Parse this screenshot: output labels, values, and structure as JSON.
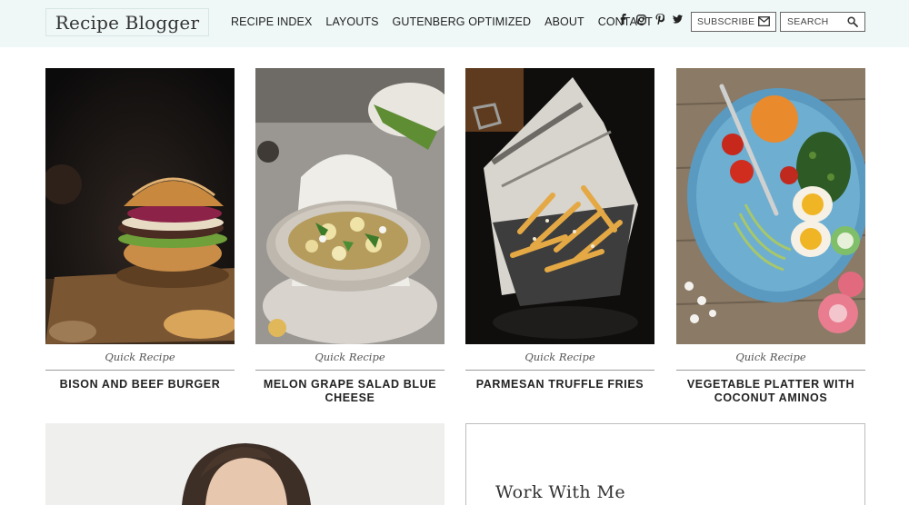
{
  "header": {
    "logo": "Recipe Blogger",
    "nav": [
      "RECIPE INDEX",
      "LAYOUTS",
      "GUTENBERG OPTIMIZED",
      "ABOUT",
      "CONTACT"
    ],
    "social_icons": [
      "facebook-icon",
      "instagram-icon",
      "pinterest-icon",
      "twitter-icon"
    ],
    "subscribe_label": "SUBSCRIBE",
    "search_label": "SEARCH"
  },
  "cards": [
    {
      "category": "Quick Recipe",
      "title": "BISON AND BEEF BURGER"
    },
    {
      "category": "Quick Recipe",
      "title": "MELON GRAPE SALAD BLUE CHEESE"
    },
    {
      "category": "Quick Recipe",
      "title": "PARMESAN TRUFFLE FRIES"
    },
    {
      "category": "Quick Recipe",
      "title": "VEGETABLE PLATTER WITH COCONUT AMINOS"
    }
  ],
  "work_with_me": {
    "title": "Work With Me"
  },
  "colors": {
    "header_bg": "#eff8f7",
    "text": "#222222"
  }
}
